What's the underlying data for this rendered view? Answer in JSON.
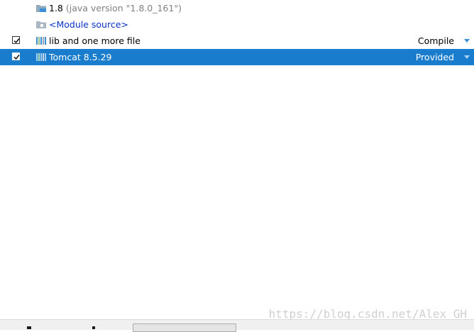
{
  "rows": [
    {
      "label": "1.8",
      "sub": "(java version \"1.8.0_161\")"
    },
    {
      "label": "<Module source>"
    },
    {
      "label": "lib and one more file",
      "scope": "Compile",
      "checked": true
    },
    {
      "label": "Tomcat 8.5.29",
      "scope": "Provided",
      "checked": true,
      "selected": true
    }
  ],
  "watermark": "https://blog.csdn.net/Alex_GH",
  "colors": {
    "selection": "#1a7ccc",
    "link": "#0a32c8",
    "scope_arrow": "#3a8fd6"
  }
}
